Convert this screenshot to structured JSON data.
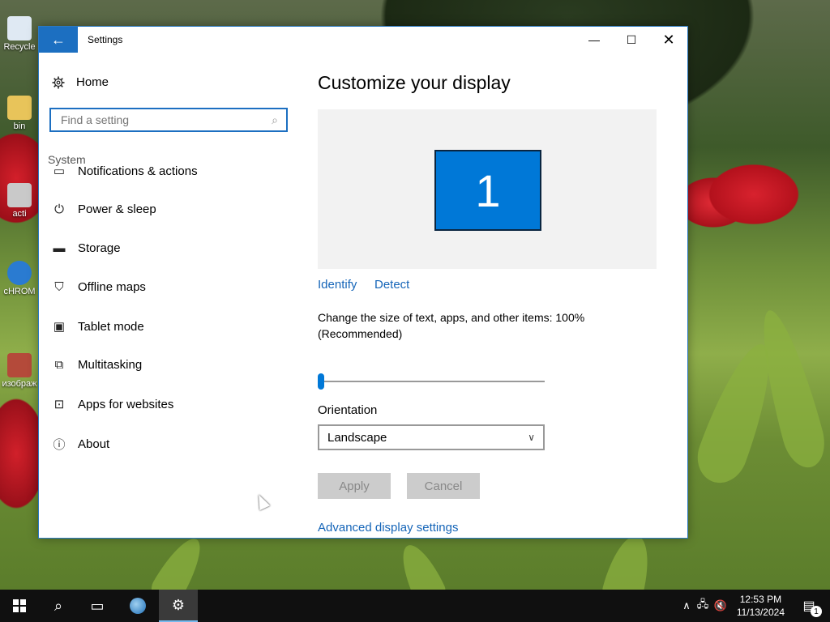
{
  "desktop": {
    "icons": [
      {
        "label": "Recycle",
        "icon": "recycle-bin-icon"
      },
      {
        "label": "bin",
        "icon": "folder-icon"
      },
      {
        "label": "acti",
        "icon": "settings-shortcut-icon"
      },
      {
        "label": "cHROM",
        "icon": "browser-shortcut-icon"
      },
      {
        "label": "изображ",
        "icon": "image-file-icon"
      }
    ]
  },
  "window": {
    "title": "Settings",
    "back_icon": "←",
    "controls": {
      "minimize": "—",
      "maximize": "☐",
      "close": "✕"
    }
  },
  "sidebar": {
    "home_label": "Home",
    "search_placeholder": "Find a setting",
    "section_label": "System",
    "items": [
      {
        "label": "Notifications & actions",
        "icon": "notifications-icon"
      },
      {
        "label": "Power & sleep",
        "icon": "power-icon"
      },
      {
        "label": "Storage",
        "icon": "storage-icon"
      },
      {
        "label": "Offline maps",
        "icon": "map-icon"
      },
      {
        "label": "Tablet mode",
        "icon": "tablet-icon"
      },
      {
        "label": "Multitasking",
        "icon": "multitasking-icon"
      },
      {
        "label": "Apps for websites",
        "icon": "apps-websites-icon"
      },
      {
        "label": "About",
        "icon": "info-icon"
      }
    ]
  },
  "main": {
    "title": "Customize your display",
    "monitor_number": "1",
    "identify_label": "Identify",
    "detect_label": "Detect",
    "scale_text": "Change the size of text, apps, and other items: 100% (Recommended)",
    "scale_value_percent": 0,
    "orientation_label": "Orientation",
    "orientation_value": "Landscape",
    "apply_label": "Apply",
    "cancel_label": "Cancel",
    "advanced_label": "Advanced display settings"
  },
  "taskbar": {
    "time": "12:53 PM",
    "date": "11/13/2024",
    "notification_count": "1"
  },
  "colors": {
    "accent": "#0078d7",
    "link": "#1565b8"
  }
}
